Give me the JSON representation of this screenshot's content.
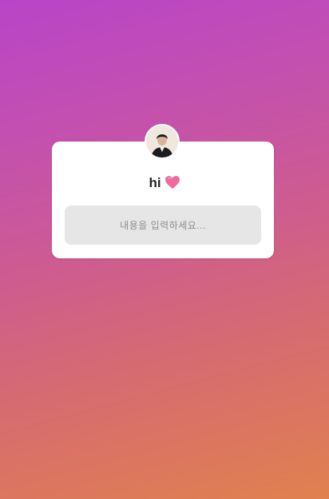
{
  "story": {
    "gradient_start": "#b944c8",
    "gradient_end": "#e0814f"
  },
  "question_sticker": {
    "prompt": "hi",
    "emoji_icon": "pink-heart-icon",
    "answer_placeholder": "내용을 입력하세요...",
    "avatar_icon": "profile-photo"
  }
}
